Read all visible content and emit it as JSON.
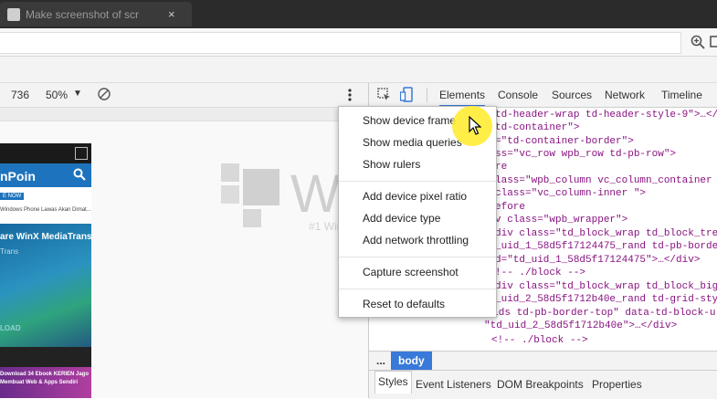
{
  "browser": {
    "tab_title": "Make screenshot of scr",
    "tab_close": "×"
  },
  "device_toolbar": {
    "height_value": "736",
    "zoom_value": "50%",
    "zoom_caret": "▼"
  },
  "viewport": {
    "phone": {
      "brand": "nPoin",
      "badge": "E NOW",
      "snippet": "Windows Phone Lawas Akan Dimat...",
      "promo_title": "are WinX MediaTrans",
      "promo_sub": "Trans",
      "promo_button": "LOAD",
      "bottom_text_1": "Download 34 Ebook KERIEN Jago",
      "bottom_text_2": "Membuat Web & Apps Sendiri"
    },
    "watermark": {
      "name": "WinPoin",
      "tagline": "#1 Windows Portal Indonesia"
    }
  },
  "devtools": {
    "tabs": [
      "Elements",
      "Console",
      "Sources",
      "Network",
      "Timeline"
    ],
    "active_tab": "Elements",
    "code_lines": [
      "td-header-wrap td-header-style-9\">…</",
      "td-container\">",
      "=\"td-container-border\">",
      "ss=\"vc_row wpb_row td-pb-row\">",
      "re",
      "lass=\"wpb_column vc_column_container t",
      "class=\"vc_column-inner \">",
      "efore",
      "v class=\"wpb_wrapper\">",
      "div class=\"td_block_wrap td_block_tre",
      "_uid_1_58d5f17124475_rand td-pb-borde",
      "d=\"td_uid_1_58d5f17124475\">…</div>",
      "!-- ./block -->",
      "div class=\"td_block_wrap td_block_big",
      "_uid_2_58d5f1712b40e_rand td-grid-sty",
      "grids td-pb-border-top\" data-td-block-u",
      "\"td_uid_2_58d5f1712b40e\">…</div>",
      "<!-- ./block -->"
    ],
    "breadcrumb_more": "...",
    "breadcrumb_body": "body",
    "subtabs": [
      "Styles",
      "Event Listeners",
      "DOM Breakpoints",
      "Properties"
    ]
  },
  "context_menu": {
    "items": [
      "Show device frame",
      "Show media queries",
      "Show rulers",
      "Add device pixel ratio",
      "Add device type",
      "Add network throttling",
      "Capture screenshot",
      "Reset to defaults"
    ]
  },
  "colors": {
    "accent_blue": "#3879d9",
    "highlight_yellow": "#ffeb28",
    "winpoin_blue": "#1e73be"
  }
}
